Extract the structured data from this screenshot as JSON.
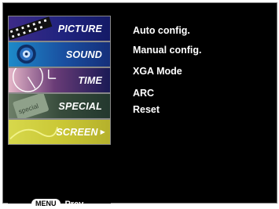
{
  "menu": {
    "items": [
      {
        "label": "PICTURE"
      },
      {
        "label": "SOUND"
      },
      {
        "label": "TIME"
      },
      {
        "label": "SPECIAL"
      },
      {
        "label": "SCREEN"
      }
    ],
    "selected_arrow": "▶"
  },
  "footer": {
    "menu_key": "MENU",
    "prev_label": "Prev."
  },
  "submenu": {
    "items": [
      {
        "label": "Auto config."
      },
      {
        "label": "Manual config."
      },
      {
        "label": "XGA Mode"
      },
      {
        "label": "ARC"
      },
      {
        "label": "Reset"
      }
    ]
  },
  "colors": {
    "background": "#000000",
    "selected_item": "#d7d84c",
    "text": "#ffffff"
  }
}
